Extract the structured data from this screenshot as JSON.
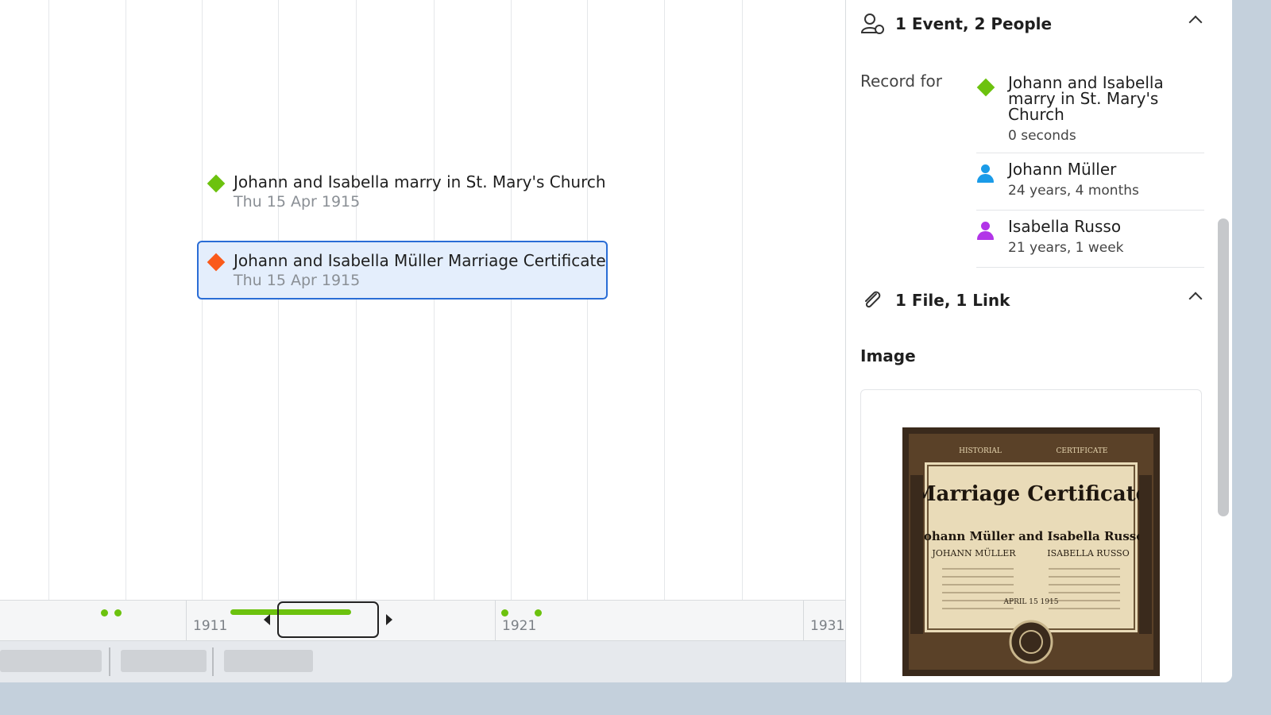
{
  "events": [
    {
      "title": "Johann and Isabella marry in St. Mary's Church",
      "date": "Thu 15 Apr 1915",
      "color": "#6cc20e",
      "selected": false
    },
    {
      "title": "Johann and Isabella Müller Marriage Certificate",
      "date": "Thu 15 Apr 1915",
      "color": "#fa5a1a",
      "selected": true
    }
  ],
  "overview": {
    "years": [
      "1911",
      "1921",
      "1931"
    ]
  },
  "panel": {
    "participants_header": "1 Event, 2 People",
    "record_for_label": "Record for",
    "records": [
      {
        "title": "Johann and Isabella marry in St. Mary's Church",
        "subtitle": "0 seconds",
        "icon": "event-diamond-icon",
        "color": "#6cc20e"
      },
      {
        "title": "Johann Müller",
        "subtitle": "24 years, 4 months",
        "icon": "person-icon",
        "color": "#1a9be8"
      },
      {
        "title": "Isabella Russo",
        "subtitle": "21 years, 1 week",
        "icon": "person-icon",
        "color": "#b234e8"
      }
    ],
    "attachments_header": "1 File, 1 Link",
    "image_label": "Image",
    "certificate": {
      "top_left": "HISTORIAL",
      "top_right": "CERTIFICATE",
      "heading": "Marriage Certificate",
      "names_script": "Johann Müller and Isabella Russo",
      "name_left": "JOHANN MÜLLER",
      "name_right": "ISABELLA RUSSO",
      "date_text": "APRIL 15 1915"
    }
  }
}
